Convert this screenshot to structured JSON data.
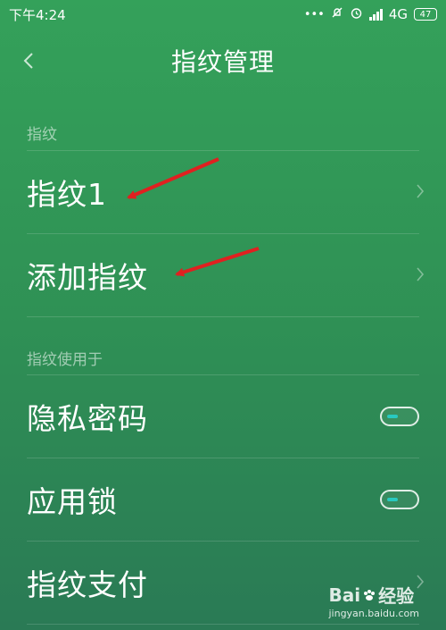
{
  "status_bar": {
    "time": "下午4:24",
    "network": "4G",
    "battery": "47"
  },
  "header": {
    "title": "指纹管理"
  },
  "sections": {
    "fingerprint": {
      "header": "指纹",
      "items": [
        {
          "label": "指纹1"
        },
        {
          "label": "添加指纹"
        }
      ]
    },
    "usage": {
      "header": "指纹使用于",
      "items": [
        {
          "label": "隐私密码"
        },
        {
          "label": "应用锁"
        },
        {
          "label": "指纹支付"
        }
      ]
    }
  },
  "annotation": {
    "arrow_color": "#e02020"
  },
  "watermark": {
    "brand_a": "Bai",
    "brand_b": "经验",
    "url": "jingyan.baidu.com"
  }
}
